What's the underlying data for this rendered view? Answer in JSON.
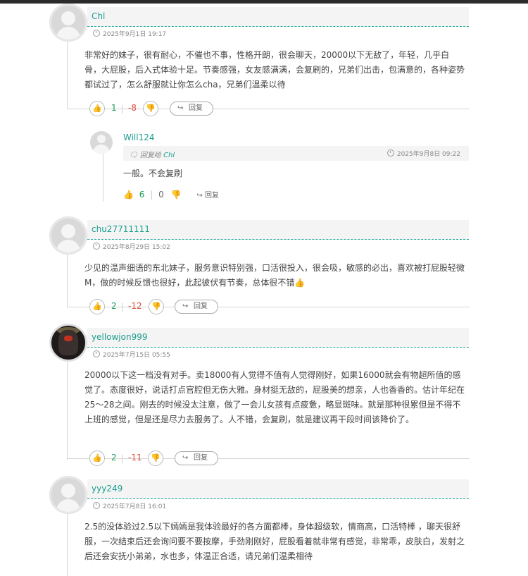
{
  "comments": [
    {
      "username": "Chl",
      "time": "2025年9月1日 19:17",
      "content": "非常好的妹子，很有耐心，不催也不事，性格开朗，很会聊天，20000以下无敌了，年轻，几乎白骨，大屁股，后入式体验十足。节奏感强，女友感满满，会复刷的，兄弟们出击，包满意的，各种姿势都试过了，怎么舒服就让你怎么cha，兄弟们温柔以待",
      "up": "1",
      "down": "-8",
      "reply_label": "回复",
      "replies": [
        {
          "username": "Will124",
          "reply_prefix": "回复给",
          "reply_to": "Chl",
          "time": "2025年9月8日 09:22",
          "content": "一般。不会复刷",
          "up": "6",
          "down": "0",
          "reply_label": "回复"
        }
      ]
    },
    {
      "username": "chu27711111",
      "time": "2025年8月29日 15:02",
      "content": "少见的温声细语的东北妹子，服务意识特别强，口活很投入，很会吸，敏感的必出，喜欢被打屁股轻微M，做的时候反馈也很好，此起彼伏有节奏，总体很不错👍",
      "up": "2",
      "down": "-12",
      "reply_label": "回复"
    },
    {
      "username": "yellowjon999",
      "time": "2025年7月15日 05:55",
      "content": "20000以下这一档没有对手。卖18000有人觉得不值有人觉得刚好，如果16000就会有物超所值的感觉了。态度很好，说话打点官腔但无伤大雅。身材挺无敌的，屁股美的想亲，人也香香的。估计年纪在25～28之间。刚去的时候没太注意，做了一会儿女孩有点疲惫，略显斑味。就是那种很累但是不得不上班的感觉，但是还是尽力去服务了。人不错，会复刷，就是建议再干段时间该降价了。",
      "up": "2",
      "down": "-11",
      "reply_label": "回复"
    },
    {
      "username": "yyy249",
      "time": "2025年7月8日 16:01",
      "content": "2.5的没体验过2.5以下嫣嫣是我体验最好的各方面都棒，身体超级软，情商高，口活特棒 ，聊天很舒服，一次结束后还会询问要不要按摩，手劲刚刚好，屁股看着就非常有感觉，非常乖，皮肤白，发射之后还会安抚小弟弟，水也多，体温正合适，请兄弟们温柔相待"
    }
  ]
}
